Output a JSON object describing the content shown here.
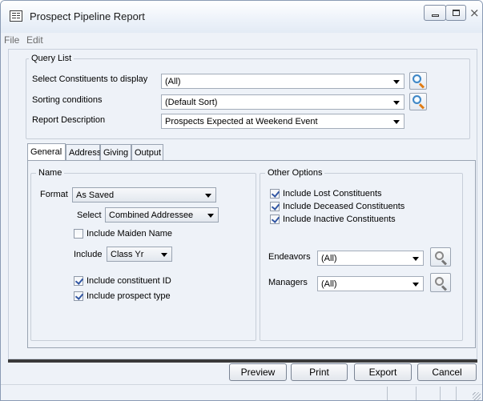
{
  "window": {
    "title": "Prospect Pipeline Report"
  },
  "menu": [
    "File",
    "Edit"
  ],
  "query_list": {
    "group_label": "Query List",
    "constituents_label": "Select Constituents to display",
    "constituents_value": "(All)",
    "sorting_label": "Sorting conditions",
    "sorting_value": "(Default Sort)",
    "description_label": "Report Description",
    "description_value": "Prospects Expected at Weekend Event"
  },
  "tabs": [
    "General",
    "Address",
    "Giving",
    "Output"
  ],
  "name_group": {
    "label": "Name",
    "format_label": "Format",
    "format_value": "As Saved",
    "select_label": "Select",
    "select_value": "Combined Addressee",
    "include_maiden": {
      "label": "Include Maiden Name",
      "checked": false
    },
    "include_label": "Include",
    "include_value": "Class Yr",
    "include_constituent_id": {
      "label": "Include constituent ID",
      "checked": true
    },
    "include_prospect_type": {
      "label": "Include prospect type",
      "checked": true
    }
  },
  "other_options": {
    "label": "Other Options",
    "lost": {
      "label": "Include Lost Constituents",
      "checked": true
    },
    "deceased": {
      "label": "Include Deceased Constituents",
      "checked": true
    },
    "inactive": {
      "label": "Include Inactive Constituents",
      "checked": true
    },
    "endeavors_label": "Endeavors",
    "endeavors_value": "(All)",
    "managers_label": "Managers",
    "managers_value": "(All)"
  },
  "buttons": {
    "preview": "Preview",
    "print": "Print",
    "export": "Export",
    "cancel": "Cancel"
  },
  "icons": [
    "app-report-icon",
    "minimize-icon",
    "maximize-icon",
    "close-icon",
    "search-icon",
    "dropdown-arrow-icon",
    "checkbox-icon",
    "resize-grip-icon"
  ]
}
